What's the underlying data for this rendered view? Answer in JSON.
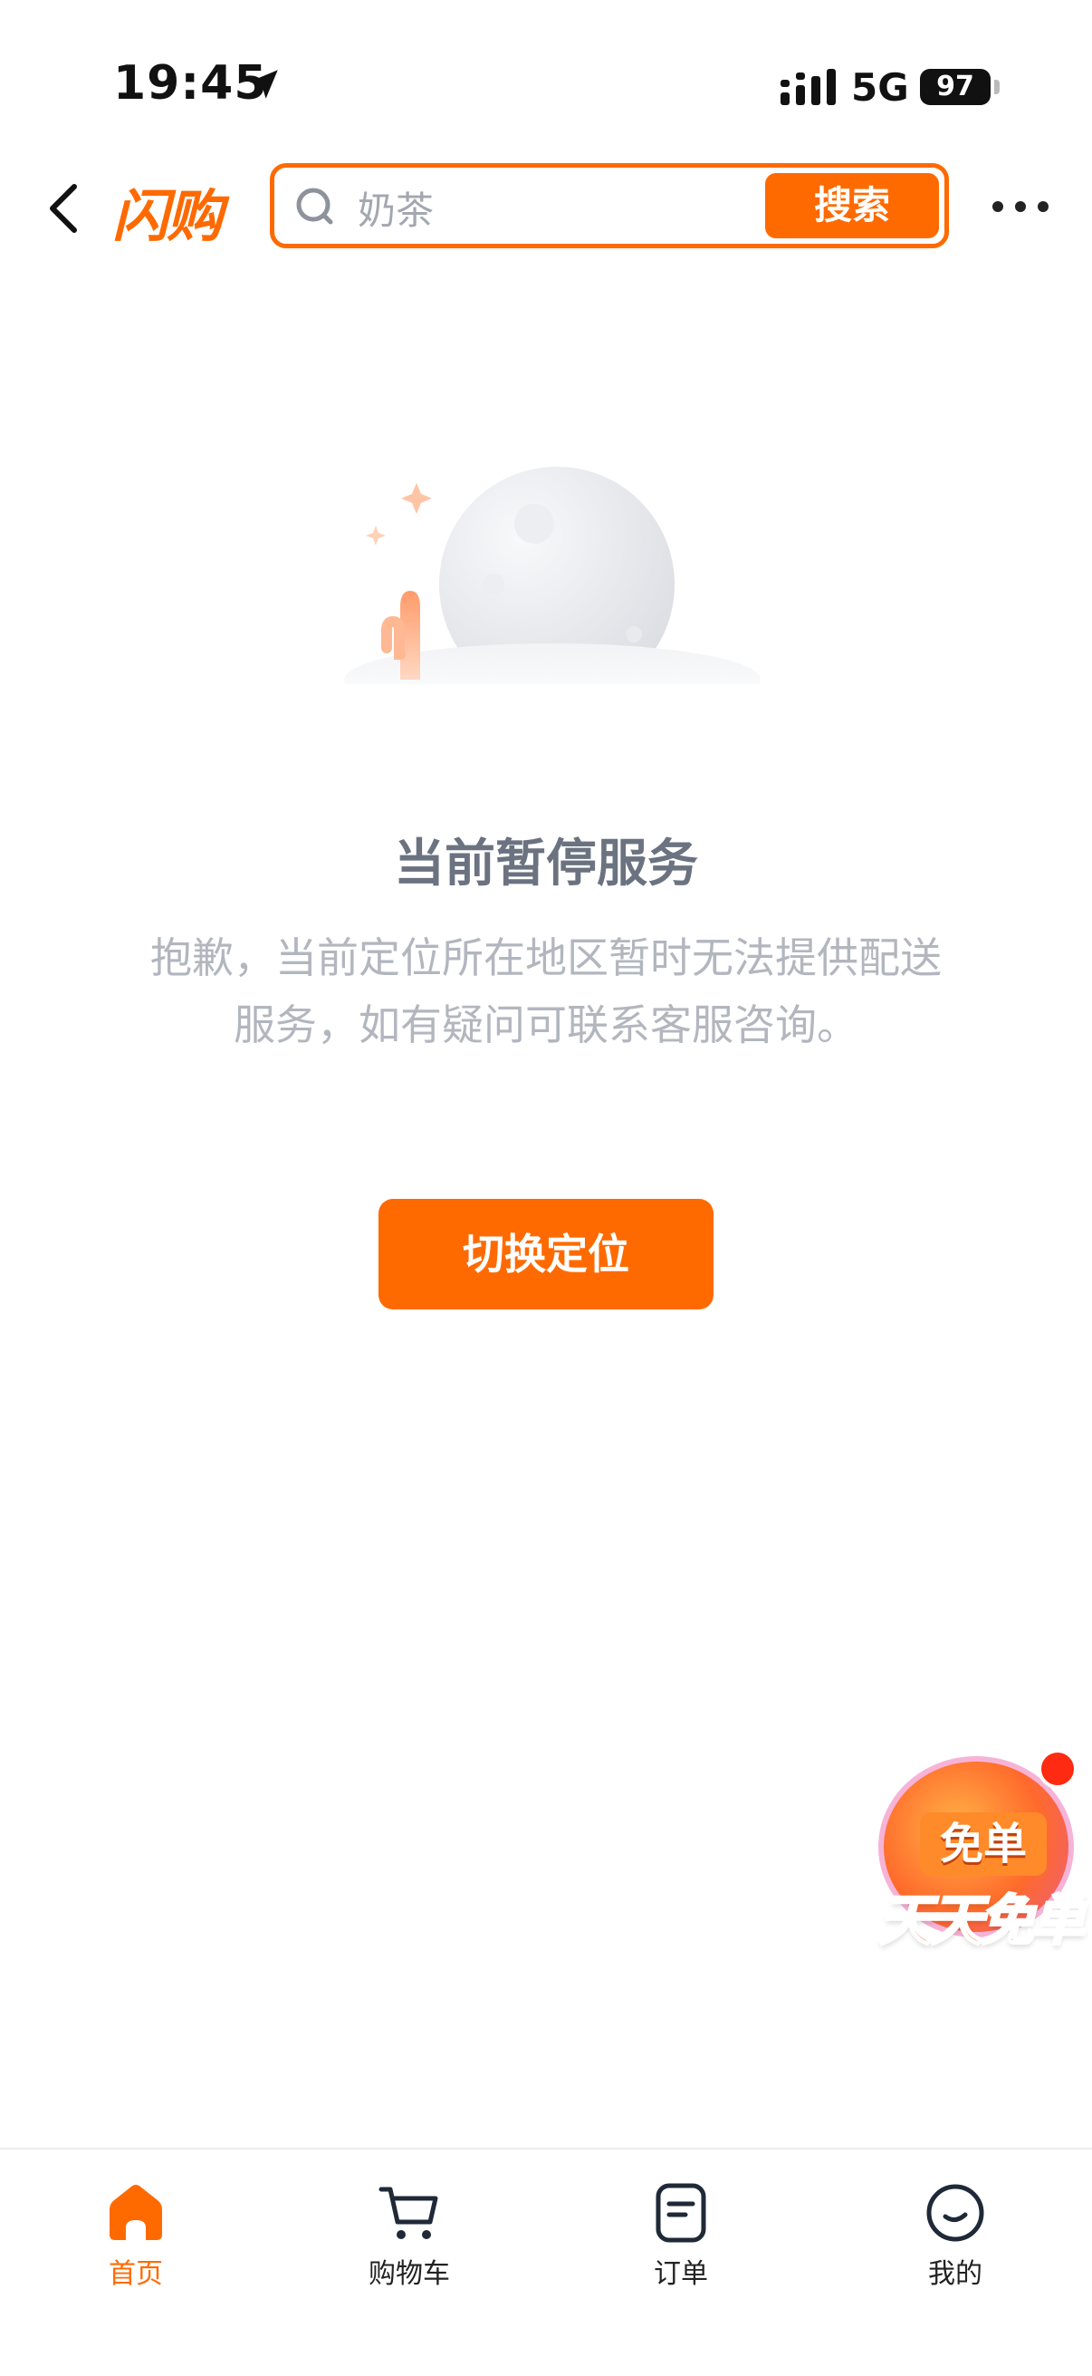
{
  "status_bar": {
    "time": "19:45",
    "network": "5G",
    "battery": "97"
  },
  "header": {
    "logo": "闪购",
    "search_placeholder": "奶茶",
    "search_button": "搜索"
  },
  "empty_state": {
    "title": "当前暂停服务",
    "description": "抱歉，当前定位所在地区暂时无法提供配送服务，如有疑问可联系客服咨询。",
    "button": "切换定位"
  },
  "promo": {
    "top_text": "免单",
    "banner_text": "天天免单"
  },
  "tab_bar": {
    "items": [
      {
        "label": "首页",
        "icon": "home-icon",
        "active": true
      },
      {
        "label": "购物车",
        "icon": "cart-icon",
        "active": false
      },
      {
        "label": "订单",
        "icon": "order-icon",
        "active": false
      },
      {
        "label": "我的",
        "icon": "profile-icon",
        "active": false
      }
    ]
  },
  "colors": {
    "accent": "#ff6a00",
    "text_muted": "#6b7280",
    "text_light": "#b2b6be"
  }
}
